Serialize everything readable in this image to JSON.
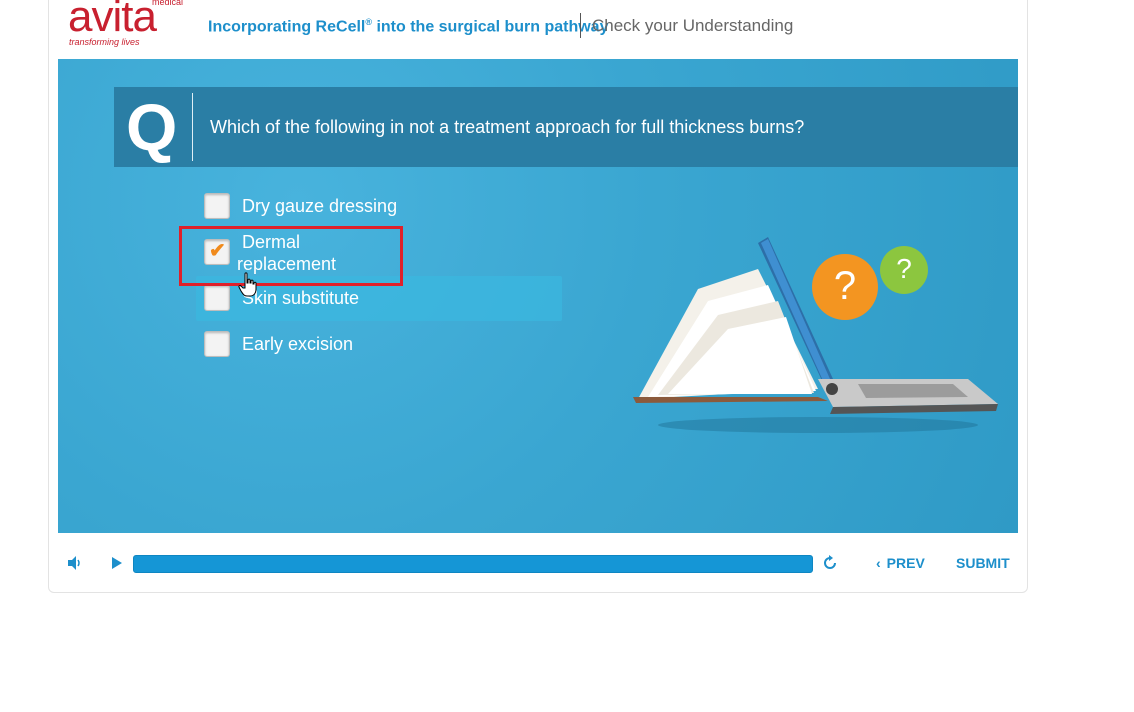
{
  "header": {
    "logo_word": "avita",
    "logo_medical": "medical",
    "logo_tagline": "transforming lives",
    "course_title": "Incorporating ReCell",
    "course_title_reg": "®",
    "course_title_rest": " into the surgical burn pathway",
    "page_title": "Check your Understanding"
  },
  "question": {
    "letter": "Q",
    "text": "Which of the following in not a treatment approach for full thickness burns?"
  },
  "options": [
    {
      "label": "Dry gauze dressing",
      "checked": false
    },
    {
      "label": "Dermal replacement",
      "line1": "Dermal",
      "line2": "replacement",
      "checked": true
    },
    {
      "label": "Skin substitute",
      "checked": false
    },
    {
      "label": "Early excision",
      "checked": false
    }
  ],
  "illustration": {
    "bubble_orange": "?",
    "bubble_green": "?"
  },
  "controls": {
    "volume_icon": "speaker-icon",
    "play_icon": "play-icon",
    "replay_icon": "replay-icon",
    "progress": 1.0,
    "prev_label": "PREV",
    "submit_label": "SUBMIT"
  },
  "colors": {
    "brand_red": "#c8202f",
    "accent_blue": "#1d8fcb",
    "stage_blue": "#3aa6d1",
    "question_bar": "#2a7ea5",
    "check_orange": "#f08a1c",
    "selection_red": "#e0202a"
  }
}
